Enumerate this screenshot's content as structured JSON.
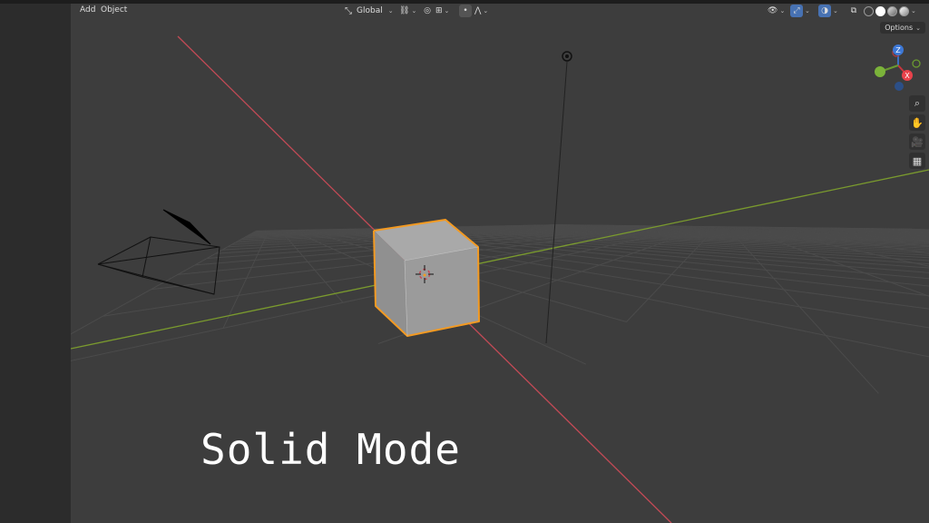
{
  "menu": {
    "add": "Add",
    "object": "Object"
  },
  "header": {
    "orientation_icon": "transform-orientation-icon",
    "orientation": "Global",
    "pivot_icon": "pivot-point-icon",
    "snap_icon": "snap-magnet-icon",
    "proportional_icon": "proportional-editing-icon"
  },
  "right_header": {
    "visibility_icon": "object-visibility-icon",
    "gizmo_icon": "gizmo-toggle-icon",
    "overlay_icon": "overlay-toggle-icon",
    "xray_icon": "xray-toggle-icon",
    "shading_modes": [
      "wireframe",
      "solid",
      "material-preview",
      "rendered"
    ],
    "active_shading": "solid"
  },
  "options": {
    "label": "Options"
  },
  "nav_gizmo": {
    "x": "X",
    "y": "Y",
    "z": "Z"
  },
  "side_tools": [
    "zoom-icon",
    "hand-pan-icon",
    "camera-view-icon",
    "perspective-grid-icon"
  ],
  "caption": "Solid Mode",
  "colors": {
    "viewport_bg": "#3d3d3d",
    "x_axis": "#c34a56",
    "y_axis": "#7a9a2e",
    "selection_outline": "#f39a22",
    "accent_blue": "#4772b3"
  }
}
